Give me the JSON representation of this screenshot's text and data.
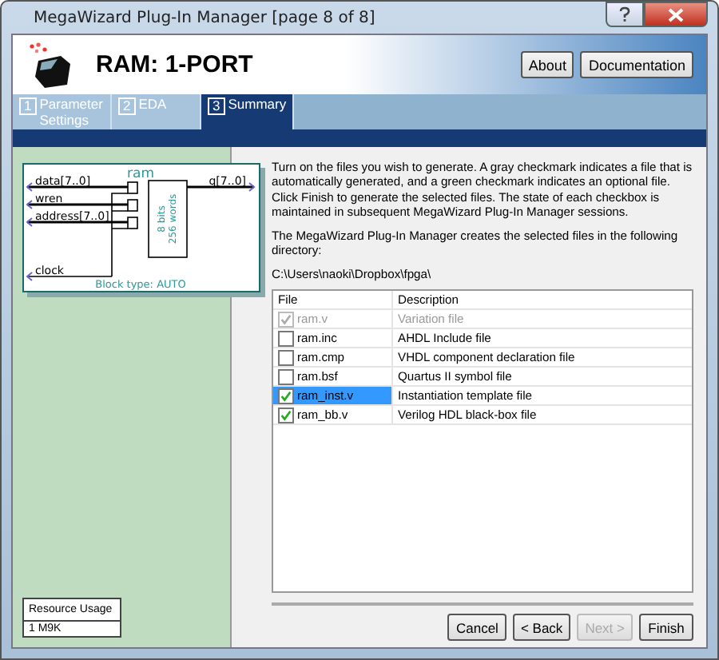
{
  "window": {
    "title": "MegaWizard Plug-In Manager [page 8 of 8]"
  },
  "header": {
    "title": "RAM: 1-PORT",
    "buttons": [
      "About",
      "Documentation"
    ]
  },
  "tabs": [
    {
      "number": "1",
      "label": "Parameter Settings",
      "selected": false
    },
    {
      "number": "2",
      "label": "EDA",
      "selected": false
    },
    {
      "number": "3",
      "label": "Summary",
      "selected": true
    }
  ],
  "symbol": {
    "name": "ram",
    "inputs": [
      "data[7..0]",
      "wren",
      "address[7..0]",
      "clock"
    ],
    "outputs": [
      "q[7..0]"
    ],
    "core_labels": [
      "8 bits",
      "256 words"
    ],
    "block_type": "Block type: AUTO"
  },
  "resource_usage": {
    "heading": "Resource Usage",
    "value": "1 M9K"
  },
  "intro": "Turn on the files you wish to generate. A gray checkmark indicates a file that is automatically generated, and a green checkmark indicates an optional file. Click Finish to generate the selected files. The state of each checkbox is maintained in subsequent MegaWizard Plug-In Manager sessions.",
  "directory_note": "The MegaWizard Plug-In Manager creates the selected files in the following directory:",
  "directory": "C:\\Users\\naoki\\Dropbox\\fpga\\",
  "table": {
    "columns": [
      "File",
      "Description"
    ],
    "rows": [
      {
        "file": "ram.v",
        "description": "Variation file",
        "checked": true,
        "disabled": true,
        "selected": false
      },
      {
        "file": "ram.inc",
        "description": "AHDL Include file",
        "checked": false,
        "disabled": false,
        "selected": false
      },
      {
        "file": "ram.cmp",
        "description": "VHDL component declaration file",
        "checked": false,
        "disabled": false,
        "selected": false
      },
      {
        "file": "ram.bsf",
        "description": "Quartus II symbol file",
        "checked": false,
        "disabled": false,
        "selected": false
      },
      {
        "file": "ram_inst.v",
        "description": "Instantiation template file",
        "checked": true,
        "disabled": false,
        "selected": true
      },
      {
        "file": "ram_bb.v",
        "description": "Verilog HDL black-box file",
        "checked": true,
        "disabled": false,
        "selected": false
      }
    ]
  },
  "footer_buttons": [
    {
      "label": "Cancel",
      "disabled": false
    },
    {
      "label": "< Back",
      "disabled": false
    },
    {
      "label": "Next >",
      "disabled": true
    },
    {
      "label": "Finish",
      "disabled": false
    }
  ]
}
